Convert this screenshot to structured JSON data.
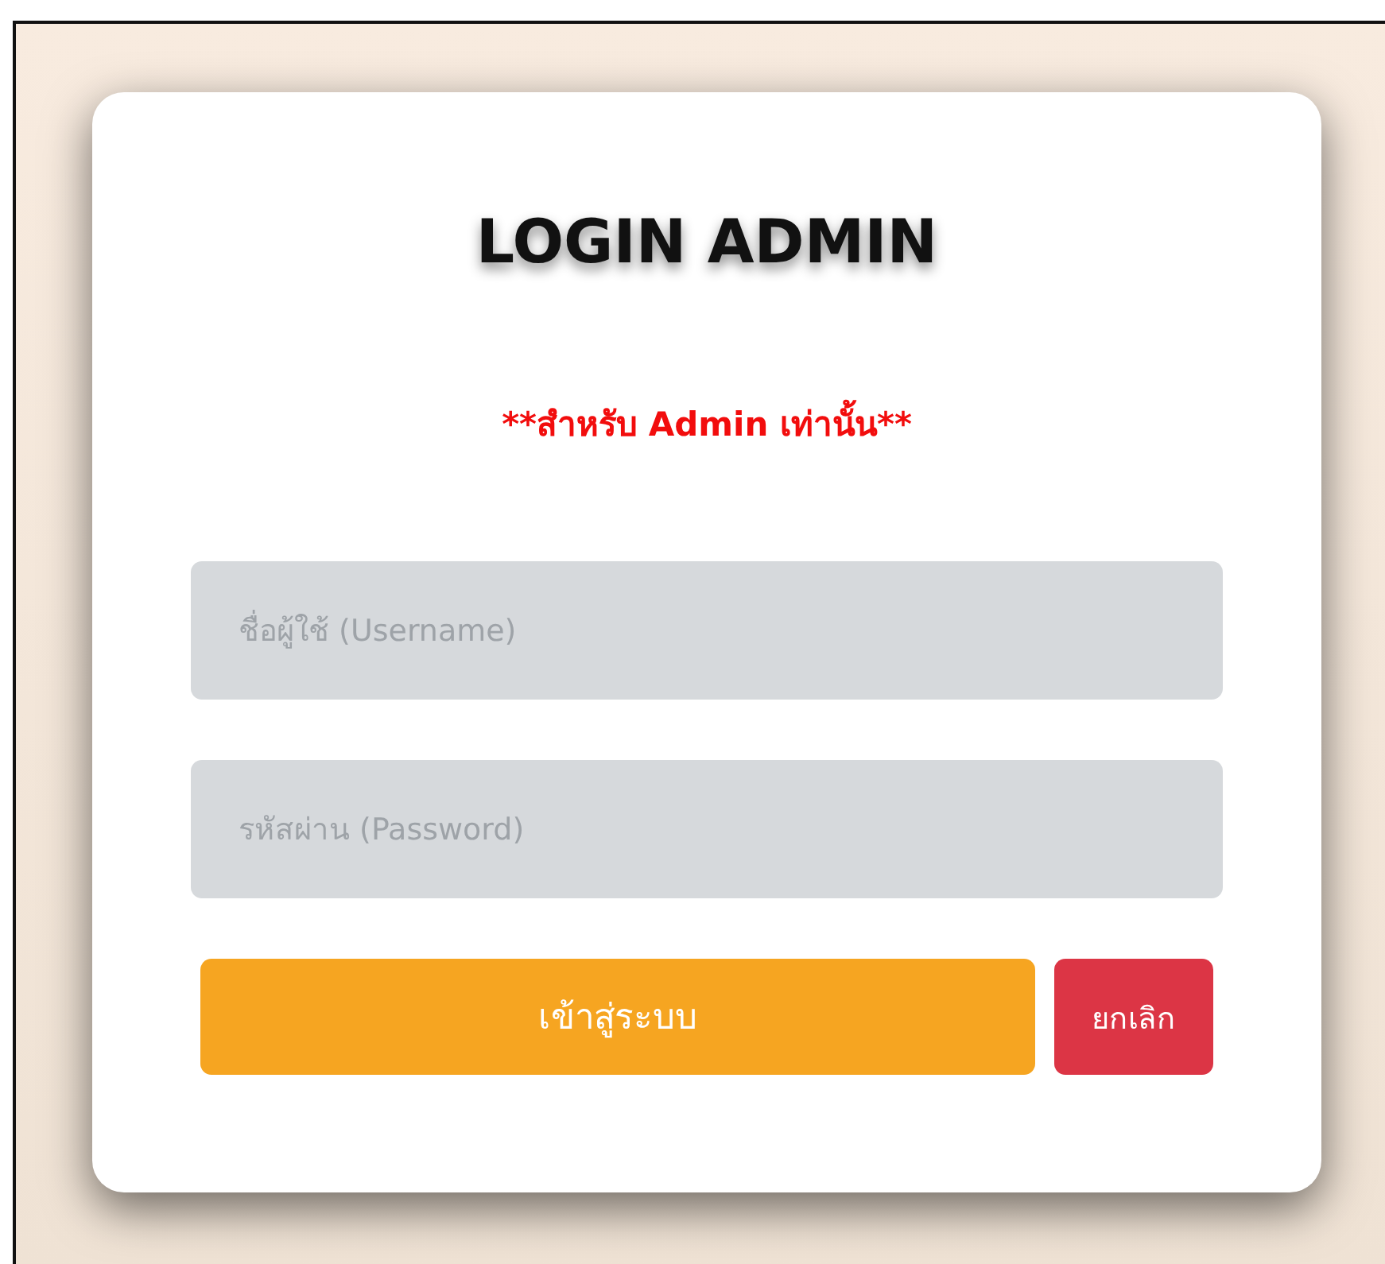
{
  "title": "LOGIN ADMIN",
  "notice": "**สำหรับ Admin เท่านั้น**",
  "fields": [
    {
      "placeholder": "ชื่อผู้ใช้ (Username)"
    },
    {
      "placeholder": "รหัสผ่าน (Password)"
    }
  ],
  "buttons": [
    {
      "kind": "primary",
      "label": "เข้าสู่ระบบ"
    },
    {
      "kind": "cancel",
      "label": "ยกเลิก"
    }
  ]
}
